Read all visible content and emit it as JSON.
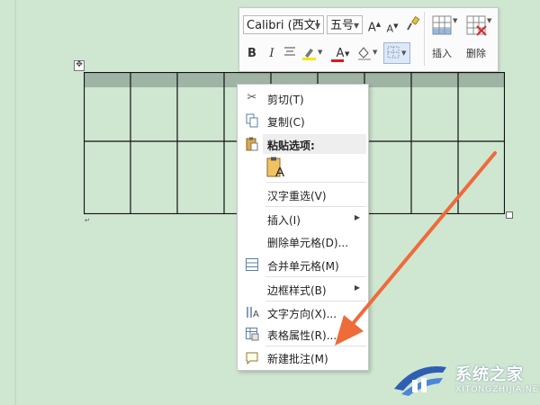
{
  "mini_toolbar": {
    "font_name": "Calibri (西文I",
    "font_size": "五号",
    "grow_font": "A",
    "shrink_font": "A",
    "bold": "B",
    "italic": "I",
    "font_color_letter": "A",
    "insert_label": "插入",
    "delete_label": "删除"
  },
  "table": {
    "columns": 9,
    "rows": 2,
    "header_row_color": "#9fb4a4"
  },
  "context_menu": {
    "items": [
      {
        "label": "剪切(T)",
        "icon": "scissors-icon"
      },
      {
        "label": "复制(C)",
        "icon": "copy-icon"
      },
      {
        "label": "粘贴选项:",
        "icon": "paste-icon"
      },
      {
        "label": "汉字重选(V)",
        "icon": ""
      },
      {
        "label": "插入(I)",
        "icon": "",
        "submenu": true
      },
      {
        "label": "删除单元格(D)...",
        "icon": ""
      },
      {
        "label": "合并单元格(M)",
        "icon": "merge-cells-icon"
      },
      {
        "label": "边框样式(B)",
        "icon": "",
        "submenu": true
      },
      {
        "label": "文字方向(X)...",
        "icon": "text-direction-icon"
      },
      {
        "label": "表格属性(R)...",
        "icon": "table-properties-icon"
      },
      {
        "label": "新建批注(M)",
        "icon": "new-comment-icon"
      }
    ],
    "paste_option_glyph": "A"
  },
  "annotation": {
    "arrow_color": "#ee6b3a"
  },
  "watermark": {
    "title": "系统之家",
    "subtitle": "XITONGZHIJIA.NET"
  }
}
